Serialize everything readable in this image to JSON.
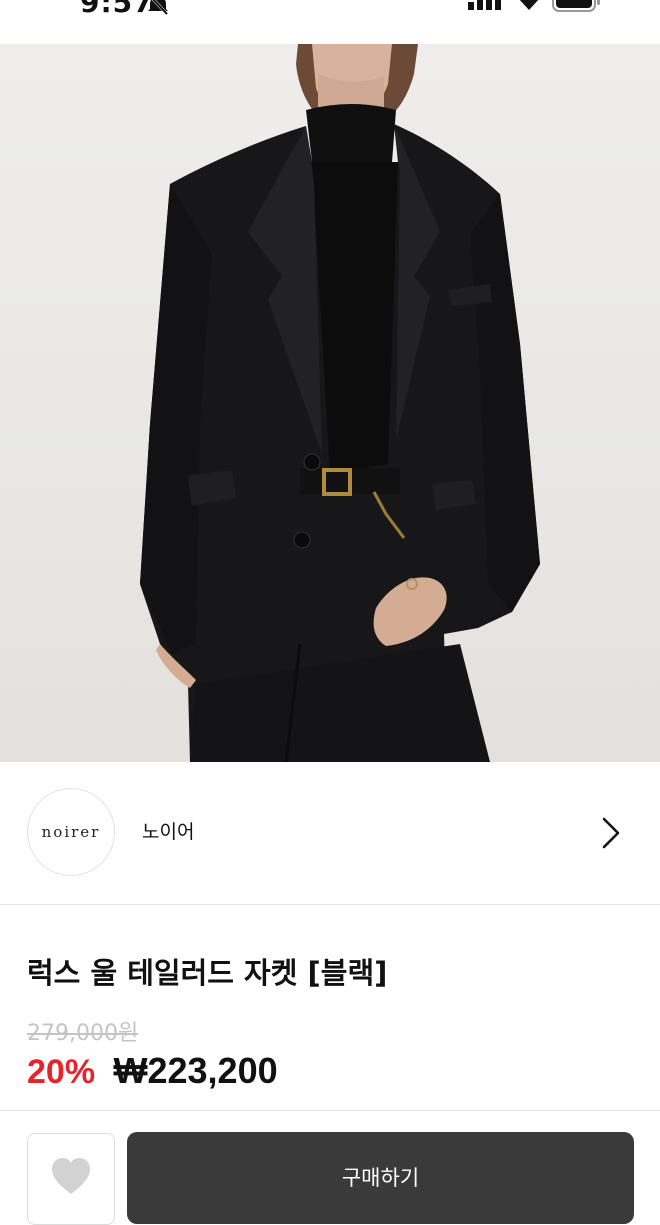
{
  "status_bar": {
    "time": "9:57",
    "icons": [
      "bell-slash-icon",
      "cellular-signal-icon",
      "wifi-icon",
      "battery-icon"
    ]
  },
  "hero_image": {
    "description_icon": "product-photo"
  },
  "brand": {
    "logo_text": "noirer",
    "name": "노이어",
    "arrow_icon": "chevron-right-icon"
  },
  "product": {
    "title": "럭스 울 테일러드 자켓 [블랙]",
    "original_price": "279,000원",
    "discount_rate": "20%",
    "sale_price": "₩223,200"
  },
  "actions": {
    "wish_icon": "heart-icon",
    "buy_label": "구매하기"
  },
  "colors": {
    "discount": "#e8232b",
    "buy_button": "#3a3a3a",
    "strike_price": "#c4c4c4"
  }
}
